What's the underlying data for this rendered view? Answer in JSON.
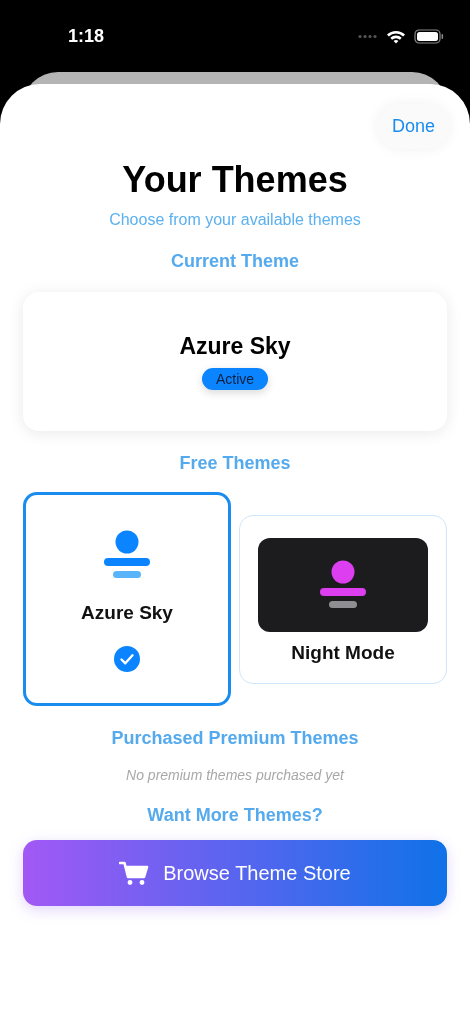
{
  "status_bar": {
    "time": "1:18"
  },
  "done_button": "Done",
  "title": "Your Themes",
  "subtitle": "Choose from your available themes",
  "current": {
    "heading": "Current Theme",
    "name": "Azure Sky",
    "badge": "Active"
  },
  "free": {
    "heading": "Free Themes",
    "themes": [
      {
        "name": "Azure Sky",
        "kind": "light",
        "selected": true
      },
      {
        "name": "Night Mode",
        "kind": "dark",
        "selected": false
      }
    ]
  },
  "premium": {
    "heading": "Purchased Premium Themes",
    "empty_text": "No premium themes purchased yet"
  },
  "more": {
    "heading": "Want More Themes?",
    "button": "Browse Theme Store"
  }
}
